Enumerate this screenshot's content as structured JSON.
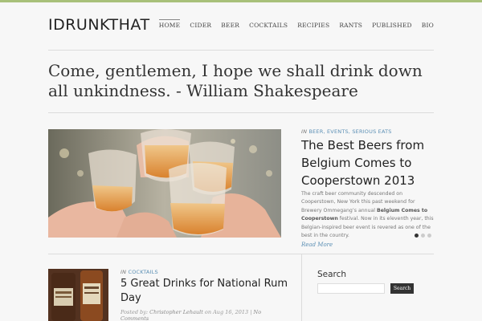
{
  "site": {
    "logo": "IDRUNKTHAT"
  },
  "nav": {
    "items": [
      "HOME",
      "CIDER",
      "BEER",
      "COCKTAILS",
      "RECIPIES",
      "RANTS",
      "PUBLISHED",
      "BIO"
    ],
    "active": "HOME"
  },
  "quote": "Come, gentlemen, I hope we shall drink down all unkindness. - William Shakespeare",
  "featured": {
    "cat_prefix": "IN",
    "categories": "BEER, EVENTS, SERIOUS EATS",
    "title": "The Best Beers from Belgium Comes to Cooperstown 2013",
    "excerpt_1": "The craft beer community descended on Cooperstown, New York this past weekend for Brewery Ommegang’s annual",
    "excerpt_bold": "Belgium Comes to Cooperstown",
    "excerpt_2": "festival. Now in its eleventh year, this Belgian-inspired beer event is revered as one of the best in the country.",
    "read_more": "Read More",
    "slides": 3,
    "active_slide": 1
  },
  "post": {
    "cat_prefix": "IN",
    "category": "COCKTAILS",
    "title": "5 Great Drinks for National Rum Day",
    "posted_by": "Posted by:",
    "author": "Christopher Lehault",
    "on": "on",
    "date": "Aug 16, 2013",
    "sep": "|",
    "comments": "No Comments"
  },
  "sidebar": {
    "search_title": "Search",
    "search_placeholder": "",
    "search_button": "Search"
  },
  "colors": {
    "accent": "#5b8fb4",
    "topbar": "#a8c07a",
    "background": "#f7f7f7"
  }
}
